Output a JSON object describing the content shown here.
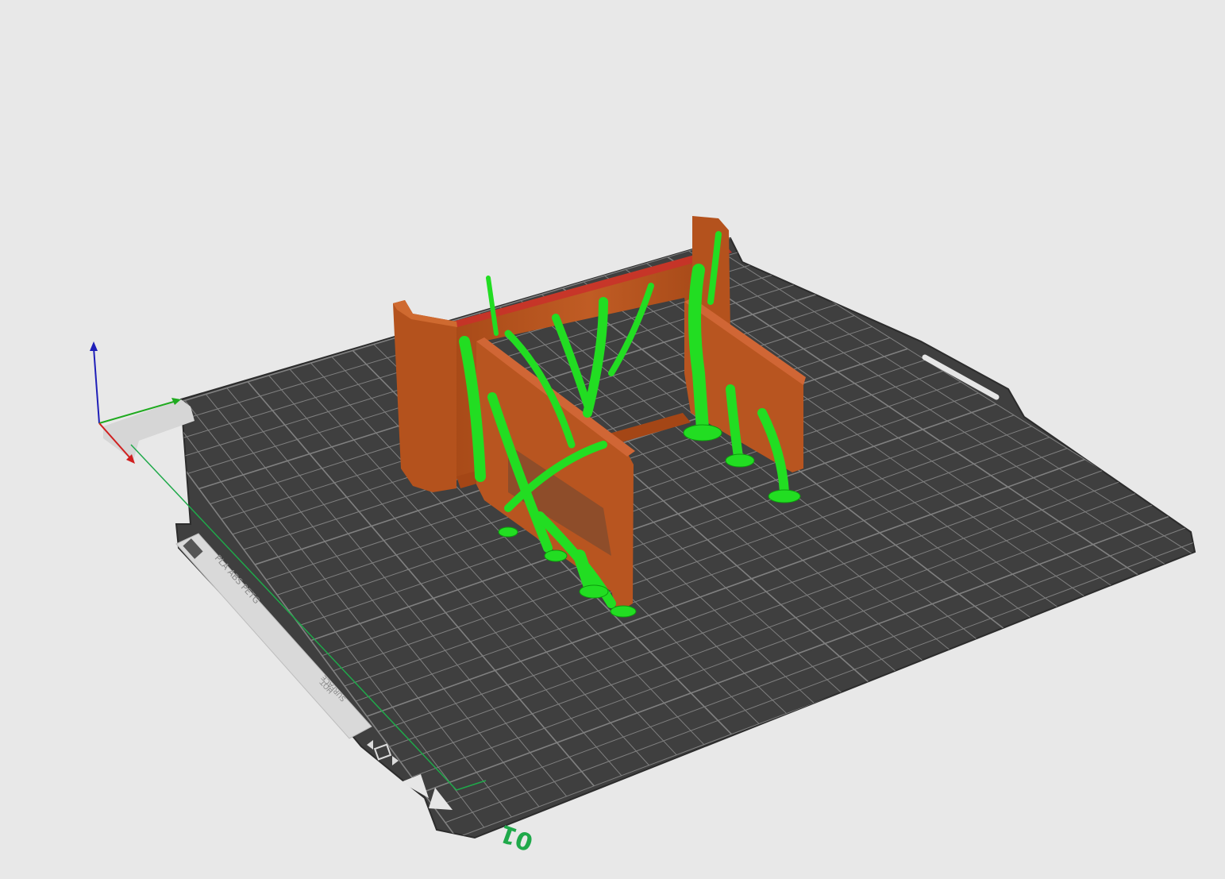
{
  "viewport": {
    "plate_label_line1": "PLA ABS PETG",
    "plate_label_line2": "HOT",
    "plate_label_line3": "SURFACE",
    "plate_number": "01"
  },
  "colors": {
    "background": "#e8e8e8",
    "bed_surface": "#3f3f3f",
    "bed_grid": "#8a8a8a",
    "model": "#b9561f",
    "model_top": "#c9582a",
    "support": "#22dd22",
    "support_dark": "#0d9a0d",
    "plate_number": "#1fa94a",
    "axis_x": "#d01f1f",
    "axis_y": "#1faa1f",
    "axis_z": "#1f1fb8"
  },
  "icons": {
    "axes": "axis-gizmo-icon",
    "bed_logo": "bed-logo-icon",
    "flip": "flip-plate-icon"
  }
}
